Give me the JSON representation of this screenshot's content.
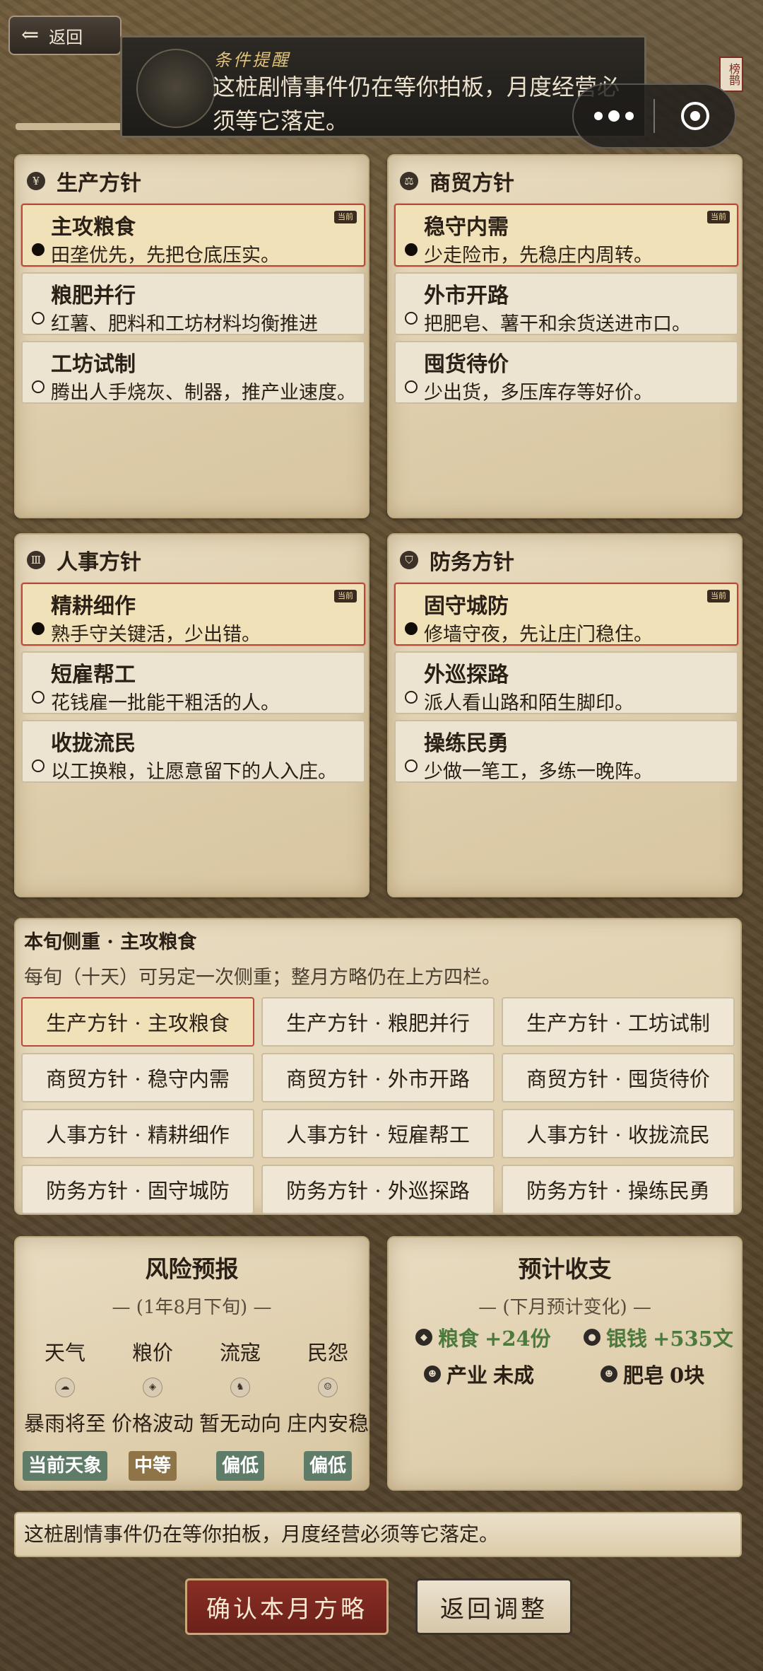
{
  "header": {
    "back_label": "返回",
    "toast_title": "条件提醒",
    "toast_text": "这桩剧情事件仍在等你拍板，月度经营必须等它落定。",
    "seal_text": "榜鹊"
  },
  "panels": [
    {
      "title": "生产方针",
      "icon": "grain-icon",
      "options": [
        {
          "name": "主攻粮食",
          "desc": "田垄优先，先把仓底压实。",
          "selected": true,
          "tag": "当前"
        },
        {
          "name": "粮肥并行",
          "desc": "红薯、肥料和工坊材料均衡推进",
          "selected": false
        },
        {
          "name": "工坊试制",
          "desc": "腾出人手烧灰、制器，推产业速度。",
          "selected": false
        }
      ]
    },
    {
      "title": "商贸方针",
      "icon": "scale-icon",
      "options": [
        {
          "name": "稳守内需",
          "desc": "少走险市，先稳庄内周转。",
          "selected": true,
          "tag": "当前"
        },
        {
          "name": "外市开路",
          "desc": "把肥皂、薯干和余货送进市口。",
          "selected": false
        },
        {
          "name": "囤货待价",
          "desc": "少出货，多压库存等好价。",
          "selected": false
        }
      ]
    },
    {
      "title": "人事方针",
      "icon": "people-icon",
      "options": [
        {
          "name": "精耕细作",
          "desc": "熟手守关键活，少出错。",
          "selected": true,
          "tag": "当前"
        },
        {
          "name": "短雇帮工",
          "desc": "花钱雇一批能干粗活的人。",
          "selected": false
        },
        {
          "name": "收拢流民",
          "desc": "以工换粮，让愿意留下的人入庄。",
          "selected": false
        }
      ]
    },
    {
      "title": "防务方针",
      "icon": "shield-icon",
      "options": [
        {
          "name": "固守城防",
          "desc": "修墙守夜，先让庄门稳住。",
          "selected": true,
          "tag": "当前"
        },
        {
          "name": "外巡探路",
          "desc": "派人看山路和陌生脚印。",
          "selected": false
        },
        {
          "name": "操练民勇",
          "desc": "少做一笔工，多练一晚阵。",
          "selected": false
        }
      ]
    }
  ],
  "focus": {
    "title": "本旬侧重 · 主攻粮食",
    "desc": "每旬（十天）可另定一次侧重；整月方略仍在上方四栏。",
    "options": [
      "生产方针 · 主攻粮食",
      "生产方针 · 粮肥并行",
      "生产方针 · 工坊试制",
      "商贸方针 · 稳守内需",
      "商贸方针 · 外市开路",
      "商贸方针 · 囤货待价",
      "人事方针 · 精耕细作",
      "人事方针 · 短雇帮工",
      "人事方针 · 收拢流民",
      "防务方针 · 固守城防",
      "防务方针 · 外巡探路",
      "防务方针 · 操练民勇"
    ],
    "selected_index": 0
  },
  "risk": {
    "title": "风险预报",
    "subtitle": "— (1年8月下旬) —",
    "items": [
      {
        "label": "天气",
        "icon": "cloud-icon",
        "value": "暴雨将至",
        "badge": "当前天象",
        "badge_color": "#5f7c68"
      },
      {
        "label": "粮价",
        "icon": "grain-bag-icon",
        "value": "价格波动",
        "badge": "中等",
        "badge_color": "#8e7446"
      },
      {
        "label": "流寇",
        "icon": "horse-rider-icon",
        "value": "暂无动向",
        "badge": "偏低",
        "badge_color": "#5f7c68"
      },
      {
        "label": "民怨",
        "icon": "face-icon",
        "value": "庄内安稳",
        "badge": "偏低",
        "badge_color": "#5f7c68"
      }
    ]
  },
  "budget": {
    "title": "预计收支",
    "subtitle": "— (下月预计变化) —",
    "food_label": "粮食",
    "food_value": "+24份",
    "silver_label": "银钱",
    "silver_value": "+535文",
    "industry_label": "产业",
    "industry_value": "未成",
    "soap_label": "肥皂",
    "soap_value": "0块"
  },
  "notice": "这桩剧情事件仍在等你拍板，月度经营必须等它落定。",
  "actions": {
    "confirm": "确认本月方略",
    "return": "返回调整"
  },
  "colors": {
    "selected_border": "#b9473a",
    "confirm_bg": "#7a2820",
    "positive": "#4c7a3d"
  }
}
